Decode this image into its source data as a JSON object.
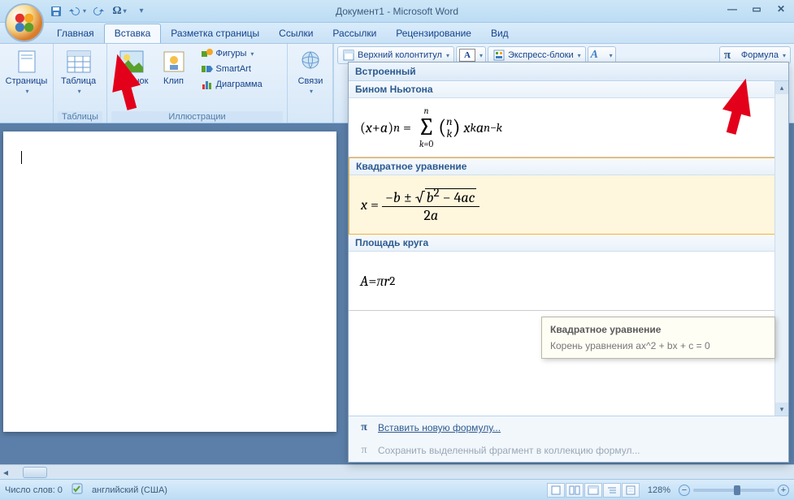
{
  "title": "Документ1 - Microsoft Word",
  "tabs": [
    "Главная",
    "Вставка",
    "Разметка страницы",
    "Ссылки",
    "Рассылки",
    "Рецензирование",
    "Вид"
  ],
  "active_tab": 1,
  "ribbon": {
    "pages": {
      "label": "Страницы",
      "btn": "Страницы"
    },
    "tables": {
      "label": "Таблицы",
      "btn": "Таблица"
    },
    "illus": {
      "label": "Иллюстрации",
      "pic": "Рисунок",
      "clip": "Клип",
      "shapes": "Фигуры",
      "smartart": "SmartArt",
      "chart": "Диаграмма"
    },
    "links": {
      "label": "",
      "btn": "Связи"
    },
    "header": "Верхний колонтитул",
    "express": "Экспресс-блоки",
    "formula": "Формула"
  },
  "gallery": {
    "section": "Встроенный",
    "items": [
      {
        "title": "Бином Ньютона"
      },
      {
        "title": "Квадратное уравнение"
      },
      {
        "title": "Площадь круга"
      }
    ],
    "footer": {
      "insert": "Вставить новую формулу...",
      "save": "Сохранить выделенный фрагмент в коллекцию формул..."
    }
  },
  "tooltip": {
    "title": "Квадратное уравнение",
    "body": "Корень уравнения ax^2 + bx + c = 0"
  },
  "status": {
    "words": "Число слов: 0",
    "lang": "английский (США)",
    "zoom": "128%"
  }
}
